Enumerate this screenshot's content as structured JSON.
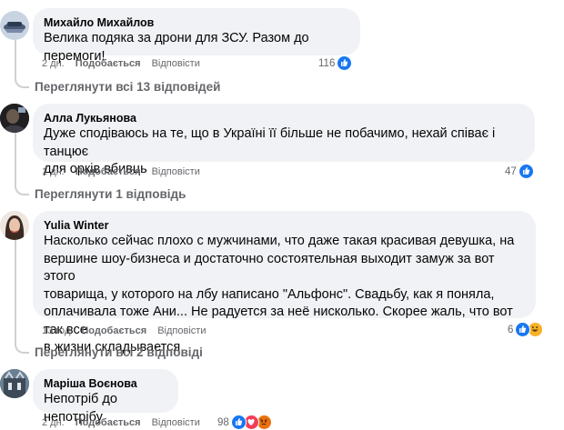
{
  "comments": [
    {
      "author": "Михайло Михайлов",
      "lines": [
        "Велика подяка за дрони для ЗСУ. Разом до перемоги!"
      ],
      "time": "2 дн.",
      "like_label": "Подобається",
      "reply_label": "Відповісти",
      "reaction_count": "116",
      "reactions": [
        "like-icon"
      ],
      "view_replies": "Переглянути всі 13 відповідей"
    },
    {
      "author": "Алла Лукьянова",
      "lines": [
        "Дуже сподіваюсь на те, що в Україні її більше не побачимо, нехай співає і танцює",
        "для орків вбивць"
      ],
      "time": "1 дн.",
      "like_label": "Подобається",
      "reply_label": "Відповісти",
      "reaction_count": "47",
      "reactions": [
        "like-icon"
      ],
      "view_replies": "Переглянути 1 відповідь"
    },
    {
      "author": "Yulia Winter",
      "lines": [
        "Насколько сейчас плохо с мужчинами, что даже такая красивая девушка, на",
        "вершине шоу-бизнеса и достаточно состоятельная выходит замуж за вот этого",
        "товарища, у которого на лбу написано \"Альфонс\". Свадьбу, как я поняла,",
        "оплачивала тоже Ани... Не радуется за неё нисколько. Скорее жаль, что вот так все",
        "в жизни складывается"
      ],
      "time": "13 год",
      "like_label": "Подобається",
      "reply_label": "Відповісти",
      "reaction_count": "6",
      "reactions": [
        "like-icon",
        "haha-icon"
      ],
      "view_replies": "Переглянути всі 2 відповіді"
    },
    {
      "author": "Маріша Воєнова",
      "lines": [
        "Непотріб до непотрібу"
      ],
      "time": "2 дн.",
      "like_label": "Подобається",
      "reply_label": "Відповісти",
      "reaction_count": "98",
      "reactions": [
        "like-icon",
        "heart-icon",
        "angry-icon"
      ],
      "view_replies": ""
    }
  ],
  "colors": {
    "bubble": "#f0f2f5",
    "meta_text": "#65676b",
    "like_blue": "#1877f2",
    "thread_line": "#ced0d4"
  }
}
